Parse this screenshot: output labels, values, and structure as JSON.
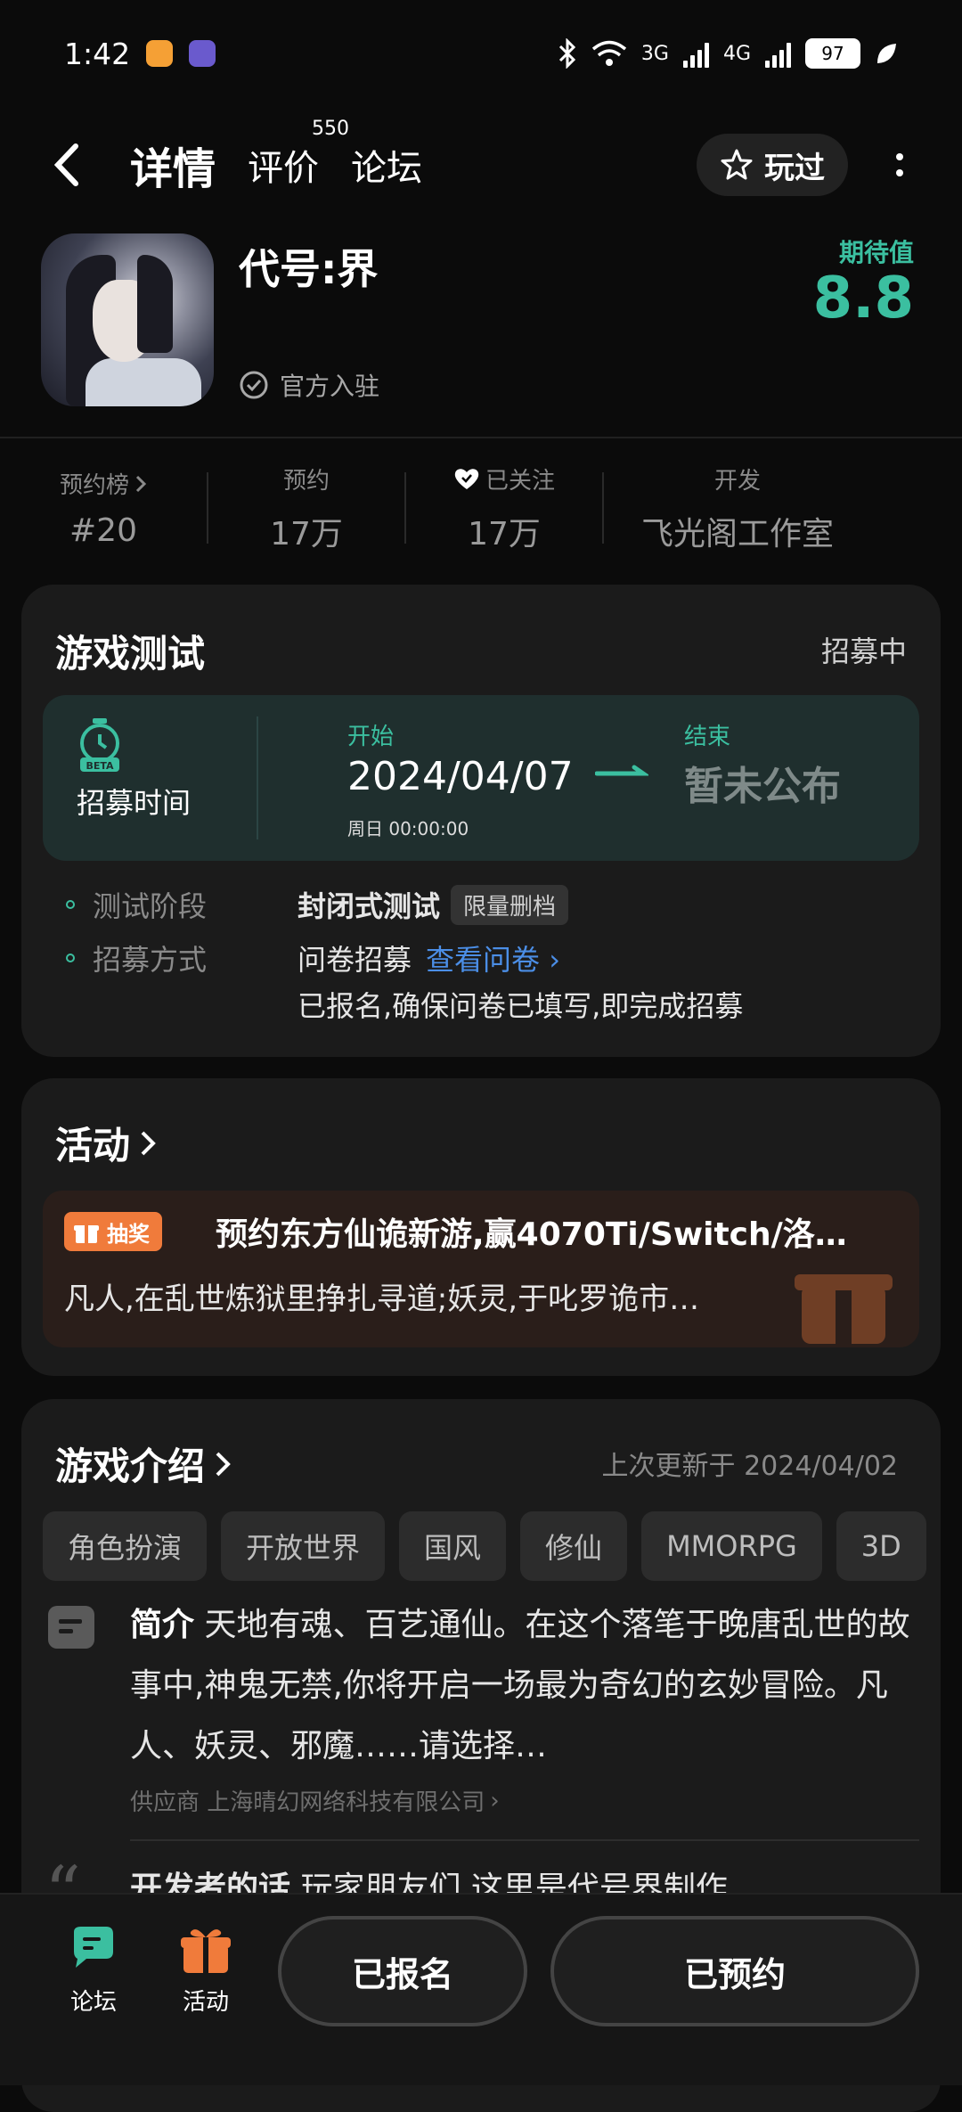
{
  "status_bar": {
    "time": "1:42",
    "battery": "97"
  },
  "header": {
    "tabs": [
      {
        "label": "详情",
        "active": true
      },
      {
        "label": "评价",
        "badge": "550"
      },
      {
        "label": "论坛"
      }
    ],
    "played_label": "玩过"
  },
  "game": {
    "name": "代号:界",
    "official_label": "官方入驻",
    "expect_label": "期待值",
    "expect_value": "8.8"
  },
  "stats": [
    {
      "label": "预约榜",
      "value": "#20"
    },
    {
      "label": "预约",
      "value": "17万"
    },
    {
      "label": "已关注",
      "value": "17万"
    },
    {
      "label": "开发",
      "value": "飞光阁工作室"
    }
  ],
  "test": {
    "title": "游戏测试",
    "status": "招募中",
    "recruit_label": "招募时间",
    "start_label": "开始",
    "start_date": "2024/04/07",
    "start_time": "周日 00:00:00",
    "end_label": "结束",
    "end_value": "暂未公布",
    "phase_key": "测试阶段",
    "phase_value": "封闭式测试",
    "phase_badge": "限量删档",
    "method_key": "招募方式",
    "method_value": "问卷招募",
    "method_link": "查看问卷",
    "method_note": "已报名,确保问卷已填写,即完成招募"
  },
  "activity": {
    "title": "活动",
    "badge": "抽奖",
    "headline": "预约东方仙诡新游,赢4070Ti/Switch/洛…",
    "desc": "凡人,在乱世炼狱里挣扎寻道;妖灵,于叱罗诡市…"
  },
  "intro": {
    "title": "游戏介绍",
    "updated": "上次更新于 2024/04/02",
    "tags": [
      "角色扮演",
      "开放世界",
      "国风",
      "修仙",
      "MMORPG",
      "3D"
    ],
    "brief_label": "简介",
    "brief_text": "天地有魂、百艺通仙。在这个落笔于晚唐乱世的故事中,神鬼无禁,你将开启一场最为奇幻的玄妙冒险。凡人、妖灵、邪魔……请选择…",
    "supplier": "供应商 上海晴幻网络科技有限公司",
    "dev_label": "开发者的话",
    "dev_text": "玩家朋友们,这里是代号界制作"
  },
  "bottom": {
    "forum_label": "论坛",
    "activity_label": "活动",
    "signed_label": "已报名",
    "reserved_label": "已预约"
  },
  "colors": {
    "accent": "#3bbfa0",
    "orange": "#f07b3b",
    "link": "#4b8ee6"
  }
}
